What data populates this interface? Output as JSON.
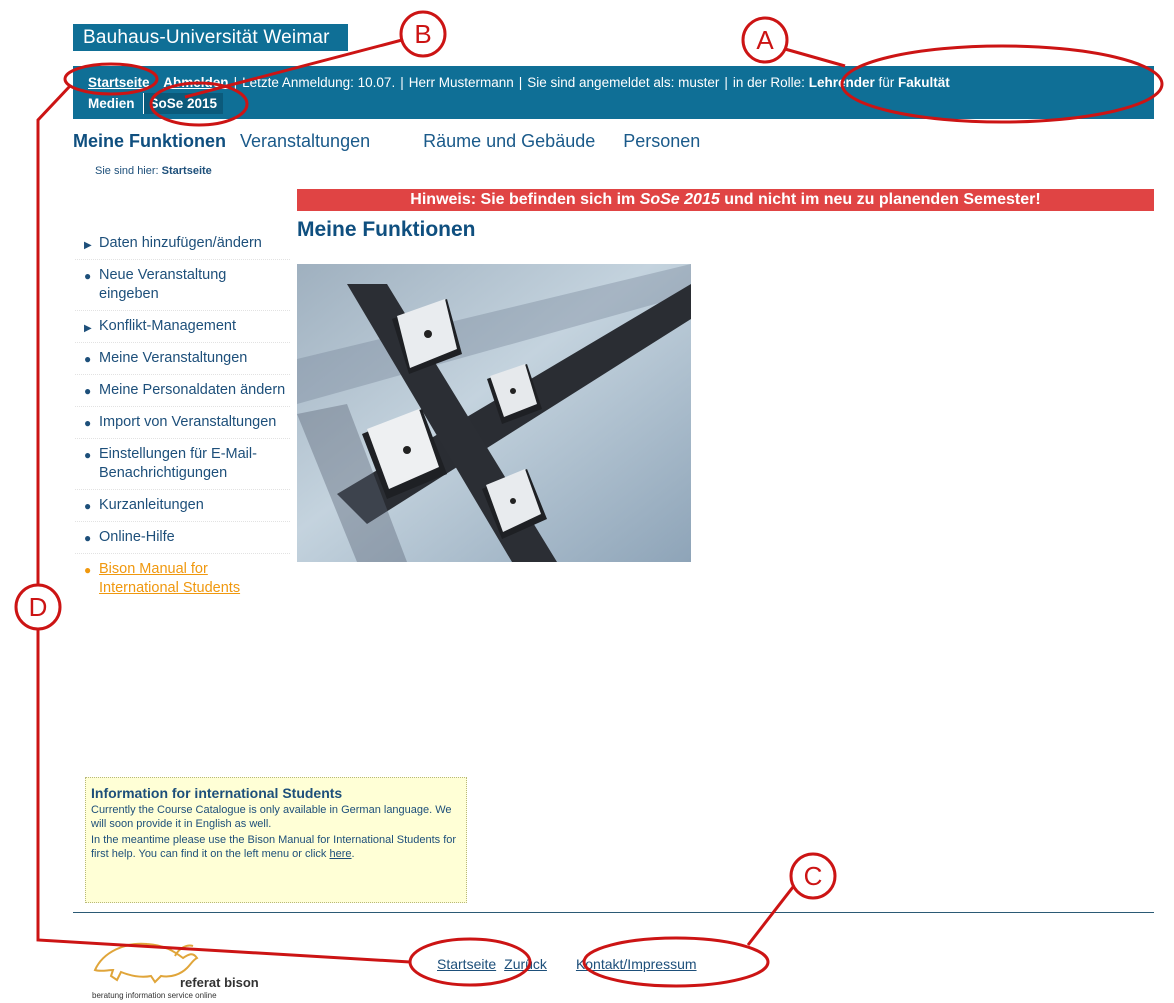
{
  "header": {
    "logo_text": "Bauhaus-Universität Weimar"
  },
  "topbar": {
    "home_link": "Startseite",
    "logout_link": "Abmelden",
    "last_login": "Letzte Anmeldung:  10.07.",
    "user_name": "Herr Mustermann",
    "logged_in_as": "Sie sind angemeldet als: muster",
    "role_prefix": "in der Rolle:",
    "role": "Lehrender",
    "for_word": "für",
    "faculty_line1": "Fakultät",
    "faculty_line2": "Medien",
    "semester": "SoSe 2015"
  },
  "nav": {
    "items": [
      "Meine Funktionen",
      "Veranstaltungen",
      "Räume und Gebäude",
      "Personen"
    ]
  },
  "breadcrumb": {
    "prefix": "Sie sind hier:",
    "current": "Startseite"
  },
  "notice": {
    "prefix": "Hinweis: Sie befinden sich im",
    "semester": "SoSe 2015",
    "suffix": "und nicht im neu zu planenden Semester!"
  },
  "page_title": "Meine Funktionen",
  "sidebar": {
    "items": [
      {
        "label": "Daten hinzufügen/ändern"
      },
      {
        "label": "Neue Veranstaltung eingeben"
      },
      {
        "label": "Konflikt-Management"
      },
      {
        "label": "Meine Veranstaltungen"
      },
      {
        "label": "Meine Personaldaten ändern"
      },
      {
        "label": "Import von Veranstaltungen"
      },
      {
        "label": "Einstellungen für E-Mail-Benachrichtigungen"
      },
      {
        "label": "Kurzanleitungen"
      },
      {
        "label": "Online-Hilfe"
      },
      {
        "label": "Bison Manual for International Students"
      }
    ]
  },
  "infobox": {
    "title": "Information for international Students",
    "para1": "Currently the Course Catalogue is only available in German language. We will soon provide it in English as well.",
    "para2": "In the meantime please use the Bison Manual for International Students for first help. You can find it on the left menu or click",
    "link": "here",
    "end": "."
  },
  "footer": {
    "home": "Startseite",
    "back": "Zurück",
    "contact": "Kontakt/Impressum",
    "bison_name": "referat bison",
    "bison_tagline": "beratung information service online"
  },
  "annotations": {
    "labels": [
      "A",
      "B",
      "C",
      "D"
    ],
    "color": "#cc1414"
  },
  "colors": {
    "header_blue": "#0f6f96",
    "notice_red": "#e04444",
    "link_orange": "#f0980e",
    "infobox_bg": "#ffffd6"
  }
}
